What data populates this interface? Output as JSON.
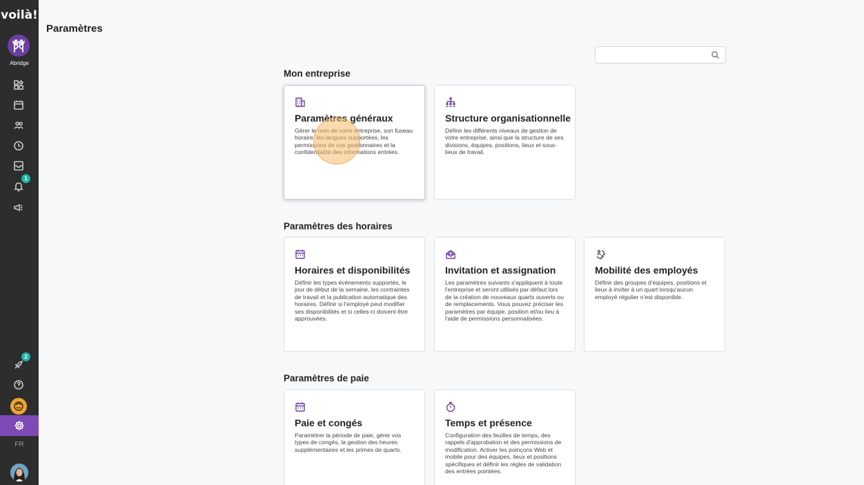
{
  "sidebar": {
    "logo": "voilà!",
    "org_name": "Abridge",
    "notifications_badge": "1",
    "updates_badge": "2",
    "language": "FR"
  },
  "header": {
    "title": "Paramètres"
  },
  "search": {
    "placeholder": "",
    "value": ""
  },
  "sections": [
    {
      "title": "Mon entreprise",
      "cards": [
        {
          "icon": "building-icon",
          "title": "Paramètres généraux",
          "description": "Gérer le nom de votre entreprise, son fuseau horaire, les langues supportées, les permissions de vos gestionnaires et la confidentialité des informations entrées."
        },
        {
          "icon": "org-chart-icon",
          "title": "Structure organisationnelle",
          "description": "Définir les différents niveaux de gestion de votre entreprise, ainsi que la structure de ses divisions, équipes, positions, lieux et sous- lieux de travail."
        }
      ]
    },
    {
      "title": "Paramètres des horaires",
      "cards": [
        {
          "icon": "calendar-icon",
          "title": "Horaires et disponibilités",
          "description": "Définir les types événements supportés, le jour de début de la semaine, les contraintes de travail et la publication automatique des horaires. Définir si l'employé peut modifier ses disponibilités et si celles-ci doivent être approuvées."
        },
        {
          "icon": "mail-open-icon",
          "title": "Invitation et assignation",
          "description": "Les paramètres suivants s'appliquent à toute l'entreprise et seront utilisés par défaut lors de la création de nouveaux quarts ouverts ou de remplacements. Vous pouvez préciser les paramètres par équipe, position et/ou lieu à l'aide de permissions personnalisées."
        },
        {
          "icon": "employee-mobility-icon",
          "title": "Mobilité des employés",
          "description": "Définir des groupes d'équipes, positions et lieux à inviter à un quart lorsqu'aucun employé régulier n'est disponible."
        }
      ]
    },
    {
      "title": "Paramètres de paie",
      "cards": [
        {
          "icon": "calendar-icon",
          "title": "Paie et congés",
          "description": "Paramétrer la période de paie, gérer vos types de congés, la gestion des heures supplémentaires et les primes de quarts."
        },
        {
          "icon": "stopwatch-icon",
          "title": "Temps et présence",
          "description": "Configuration des feuilles de temps, des rappels d'approbation et des permissions de modification. Activer les poinçons Web et mobile pour des équipes, lieux et positions spécifiques et définir les règles de validation des entrées pointées."
        }
      ]
    }
  ],
  "colors": {
    "accent": "#7e4ab5",
    "sidebar_bg": "#2d2d2d",
    "badge": "#1eb5a8",
    "page_bg": "#f7f8fa"
  }
}
